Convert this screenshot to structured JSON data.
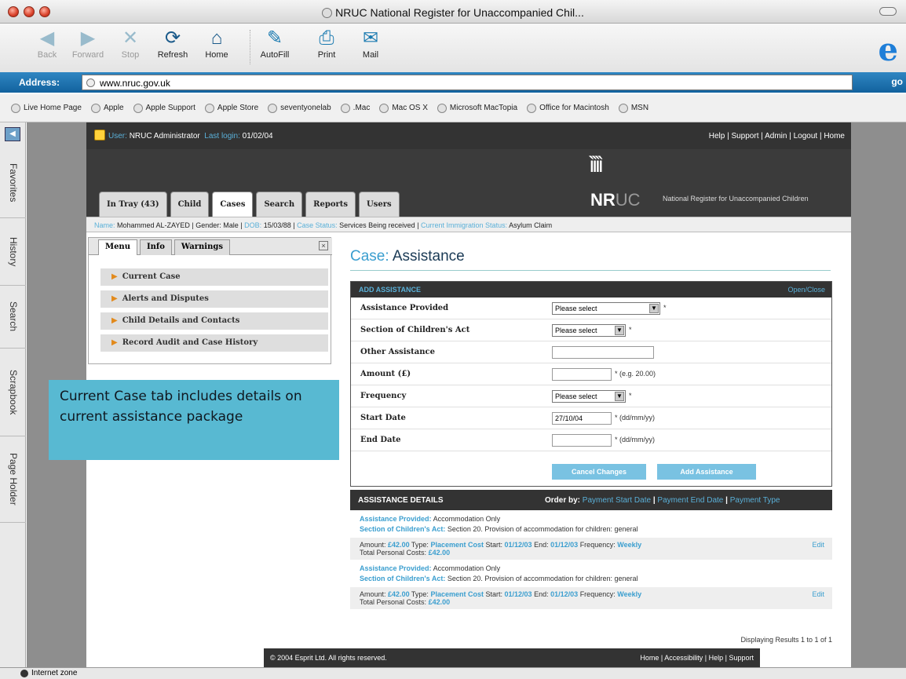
{
  "window": {
    "title": "NRUC National Register for Unaccompanied Chil..."
  },
  "toolbar": {
    "back": "Back",
    "forward": "Forward",
    "stop": "Stop",
    "refresh": "Refresh",
    "home": "Home",
    "autofill": "AutoFill",
    "print": "Print",
    "mail": "Mail"
  },
  "address": {
    "label": "Address:",
    "url": "www.nruc.gov.uk",
    "go": "go"
  },
  "favorites": [
    "Live Home Page",
    "Apple",
    "Apple Support",
    "Apple Store",
    "seventyonelab",
    ".Mac",
    "Mac OS X",
    "Microsoft MacTopia",
    "Office for Macintosh",
    "MSN"
  ],
  "sidetabs": [
    "Favorites",
    "History",
    "Search",
    "Scrapbook",
    "Page Holder"
  ],
  "status": {
    "zone": "Internet zone"
  },
  "site": {
    "user_label": "User:",
    "user_value": "NRUC Administrator",
    "last_login_label": "Last login:",
    "last_login_value": "01/02/04",
    "top_links": "Help | Support | Admin | Logout | Home",
    "logo_nr": "NR",
    "logo_uc": "UC",
    "org_name": "National Register for Unaccompanied Children",
    "tabs": [
      "In Tray (43)",
      "Child",
      "Cases",
      "Search",
      "Reports",
      "Users"
    ],
    "child": {
      "name_label": "Name:",
      "name": "Mohammed AL-ZAYED",
      "gender_label": "Gender:",
      "gender": "Male",
      "dob_label": "DOB:",
      "dob": "15/03/88",
      "case_status_label": "Case Status:",
      "case_status": "Services Being received",
      "imm_label": "Current Immigration Status:",
      "imm": "Asylum Claim"
    },
    "panel_tabs": [
      "Menu",
      "Info",
      "Warnings"
    ],
    "menu": [
      "Current Case",
      "Alerts and Disputes",
      "Child Details and Contacts",
      "Record Audit and Case History"
    ],
    "callout": "Current Case tab includes details on current assistance package",
    "case_label": "Case:",
    "case_title": "Assistance",
    "add": {
      "heading": "ADD ASSISTANCE",
      "open_close": "Open/Close",
      "fields": {
        "assistance_provided": "Assistance Provided",
        "section": "Section of Children's Act",
        "other": "Other Assistance",
        "amount": "Amount (£)",
        "frequency": "Frequency",
        "start": "Start Date",
        "end": "End Date"
      },
      "select_placeholder": "Please select",
      "required": "*",
      "amount_hint": "* (e.g. 20.00)",
      "start_value": "27/10/04",
      "date_hint": "* (dd/mm/yy)",
      "cancel": "Cancel Changes",
      "add_btn": "Add Assistance"
    },
    "details": {
      "heading": "ASSISTANCE DETAILS",
      "order_by": "Order by:",
      "order_opts": [
        "Payment Start Date",
        "Payment End Date",
        "Payment Type"
      ],
      "items": [
        {
          "ap_label": "Assistance Provided:",
          "ap": "Accommodation Only",
          "sec_label": "Section of Children's Act:",
          "sec": "Section 20. Provision of accommodation for children: general",
          "amount_label": "Amount:",
          "amount": "£42.00",
          "type_label": "Type:",
          "type": "Placement Cost",
          "start_label": "Start:",
          "start": "01/12/03",
          "end_label": "End:",
          "end": "01/12/03",
          "freq_label": "Frequency:",
          "freq": "Weekly",
          "edit": "Edit",
          "total_label": "Total Personal Costs:",
          "total": "£42.00"
        },
        {
          "ap_label": "Assistance Provided:",
          "ap": "Accommodation Only",
          "sec_label": "Section of Children's Act:",
          "sec": "Section 20. Provision of accommodation for children: general",
          "amount_label": "Amount:",
          "amount": "£42.00",
          "type_label": "Type:",
          "type": "Placement Cost",
          "start_label": "Start:",
          "start": "01/12/03",
          "end_label": "End:",
          "end": "01/12/03",
          "freq_label": "Frequency:",
          "freq": "Weekly",
          "edit": "Edit",
          "total_label": "Total Personal Costs:",
          "total": "£42.00"
        }
      ],
      "results": "Displaying Results 1 to 1 of 1"
    },
    "footer": {
      "copyright": "© 2004 Esprit Ltd. All rights reserved.",
      "links": "Home | Accessibility | Help | Support"
    }
  },
  "colors": {
    "accent": "#3a9ecf",
    "header": "#333333",
    "callout": "#58b9d2"
  }
}
